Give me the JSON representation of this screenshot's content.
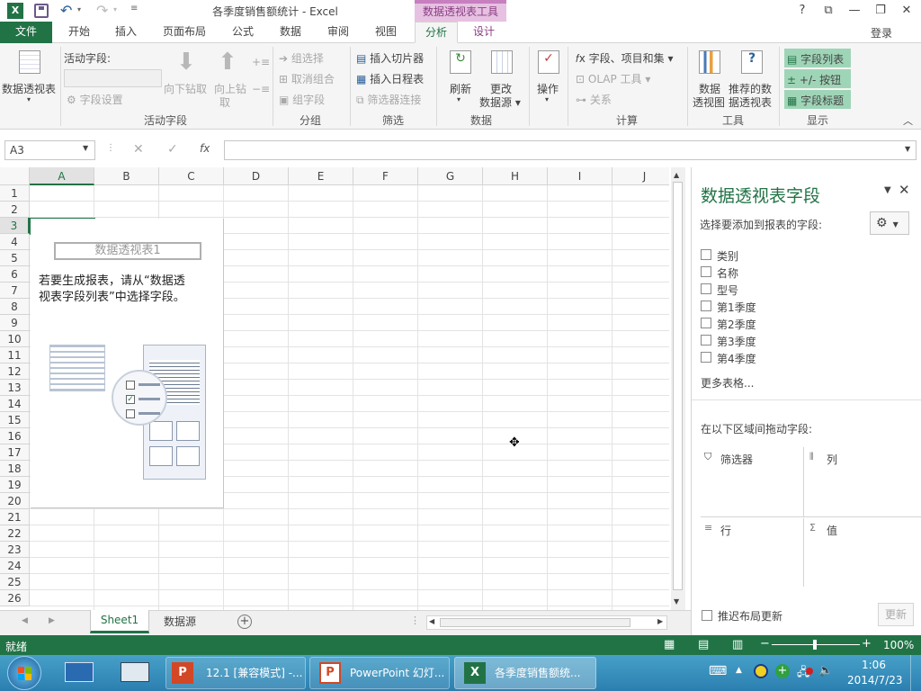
{
  "window": {
    "title": "各季度销售额统计 - Excel",
    "context_tab": "数据透视表工具",
    "signin": "登录",
    "help": "?"
  },
  "tabs": {
    "file": "文件",
    "home": "开始",
    "insert": "插入",
    "layout": "页面布局",
    "formulas": "公式",
    "data": "数据",
    "review": "审阅",
    "view": "视图",
    "analyze": "分析",
    "design": "设计"
  },
  "ribbon": {
    "pivot_btn": "数据透视表",
    "active_field_label": "活动字段:",
    "field_settings": "字段设置",
    "drill_down": "向下钻取",
    "drill_up_1": "向上钻",
    "drill_up_2": "取",
    "group_active_field": "活动字段",
    "group_selection": "组选择",
    "ungroup": "取消组合",
    "group_field": "组字段",
    "group_group": "分组",
    "insert_slicer": "插入切片器",
    "insert_timeline": "插入日程表",
    "filter_connections": "筛选器连接",
    "group_filter": "筛选",
    "refresh": "刷新",
    "change_source_1": "更改",
    "change_source_2": "数据源",
    "group_data": "数据",
    "actions": "操作",
    "fields_items": "字段、项目和集",
    "olap_tools": "OLAP 工具",
    "relationships": "关系",
    "group_calc": "计算",
    "pivot_chart_1": "数据",
    "pivot_chart_2": "透视图",
    "recommended_1": "推荐的数",
    "recommended_2": "据透视表",
    "group_tools": "工具",
    "field_list": "字段列表",
    "pm_buttons": "+/- 按钮",
    "field_headers": "字段标题",
    "group_show": "显示"
  },
  "formula_bar": {
    "name_box": "A3",
    "fx": "fx",
    "cancel": "✕",
    "enter": "✓",
    "formula_value": ""
  },
  "grid": {
    "columns": [
      "A",
      "B",
      "C",
      "D",
      "E",
      "F",
      "G",
      "H",
      "I",
      "J"
    ],
    "rows": [
      "1",
      "2",
      "3",
      "4",
      "5",
      "6",
      "7",
      "8",
      "9",
      "10",
      "11",
      "12",
      "13",
      "14",
      "15",
      "16",
      "17",
      "18",
      "19",
      "20",
      "21",
      "22",
      "23",
      "24",
      "25",
      "26"
    ],
    "selected_cell": "A3"
  },
  "placeholder": {
    "title": "数据透视表1",
    "line1": "若要生成报表，请从“数据透",
    "line2": "视表字段列表”中选择字段。"
  },
  "panel": {
    "title": "数据透视表字段",
    "choose_label": "选择要添加到报表的字段:",
    "fields": [
      "类别",
      "名称",
      "型号",
      "第1季度",
      "第2季度",
      "第3季度",
      "第4季度"
    ],
    "more_tables": "更多表格...",
    "drag_label": "在以下区域间拖动字段:",
    "area_filters": "筛选器",
    "area_columns": "列",
    "area_rows": "行",
    "area_values": "值",
    "defer_label": "推迟布局更新",
    "update_btn": "更新"
  },
  "sheets": {
    "tabs": [
      "Sheet1",
      "数据源"
    ],
    "active": "Sheet1"
  },
  "status": {
    "ready": "就绪",
    "zoom": "100%"
  },
  "taskbar": {
    "items": [
      "12.1 [兼容模式] -...",
      "PowerPoint 幻灯...",
      "各季度销售额统..."
    ],
    "time": "1:06",
    "date": "2014/7/23"
  },
  "colors": {
    "excel_green": "#217346",
    "context_purple": "#e6c1e1",
    "taskbar_blue": "#2b7fb0"
  }
}
